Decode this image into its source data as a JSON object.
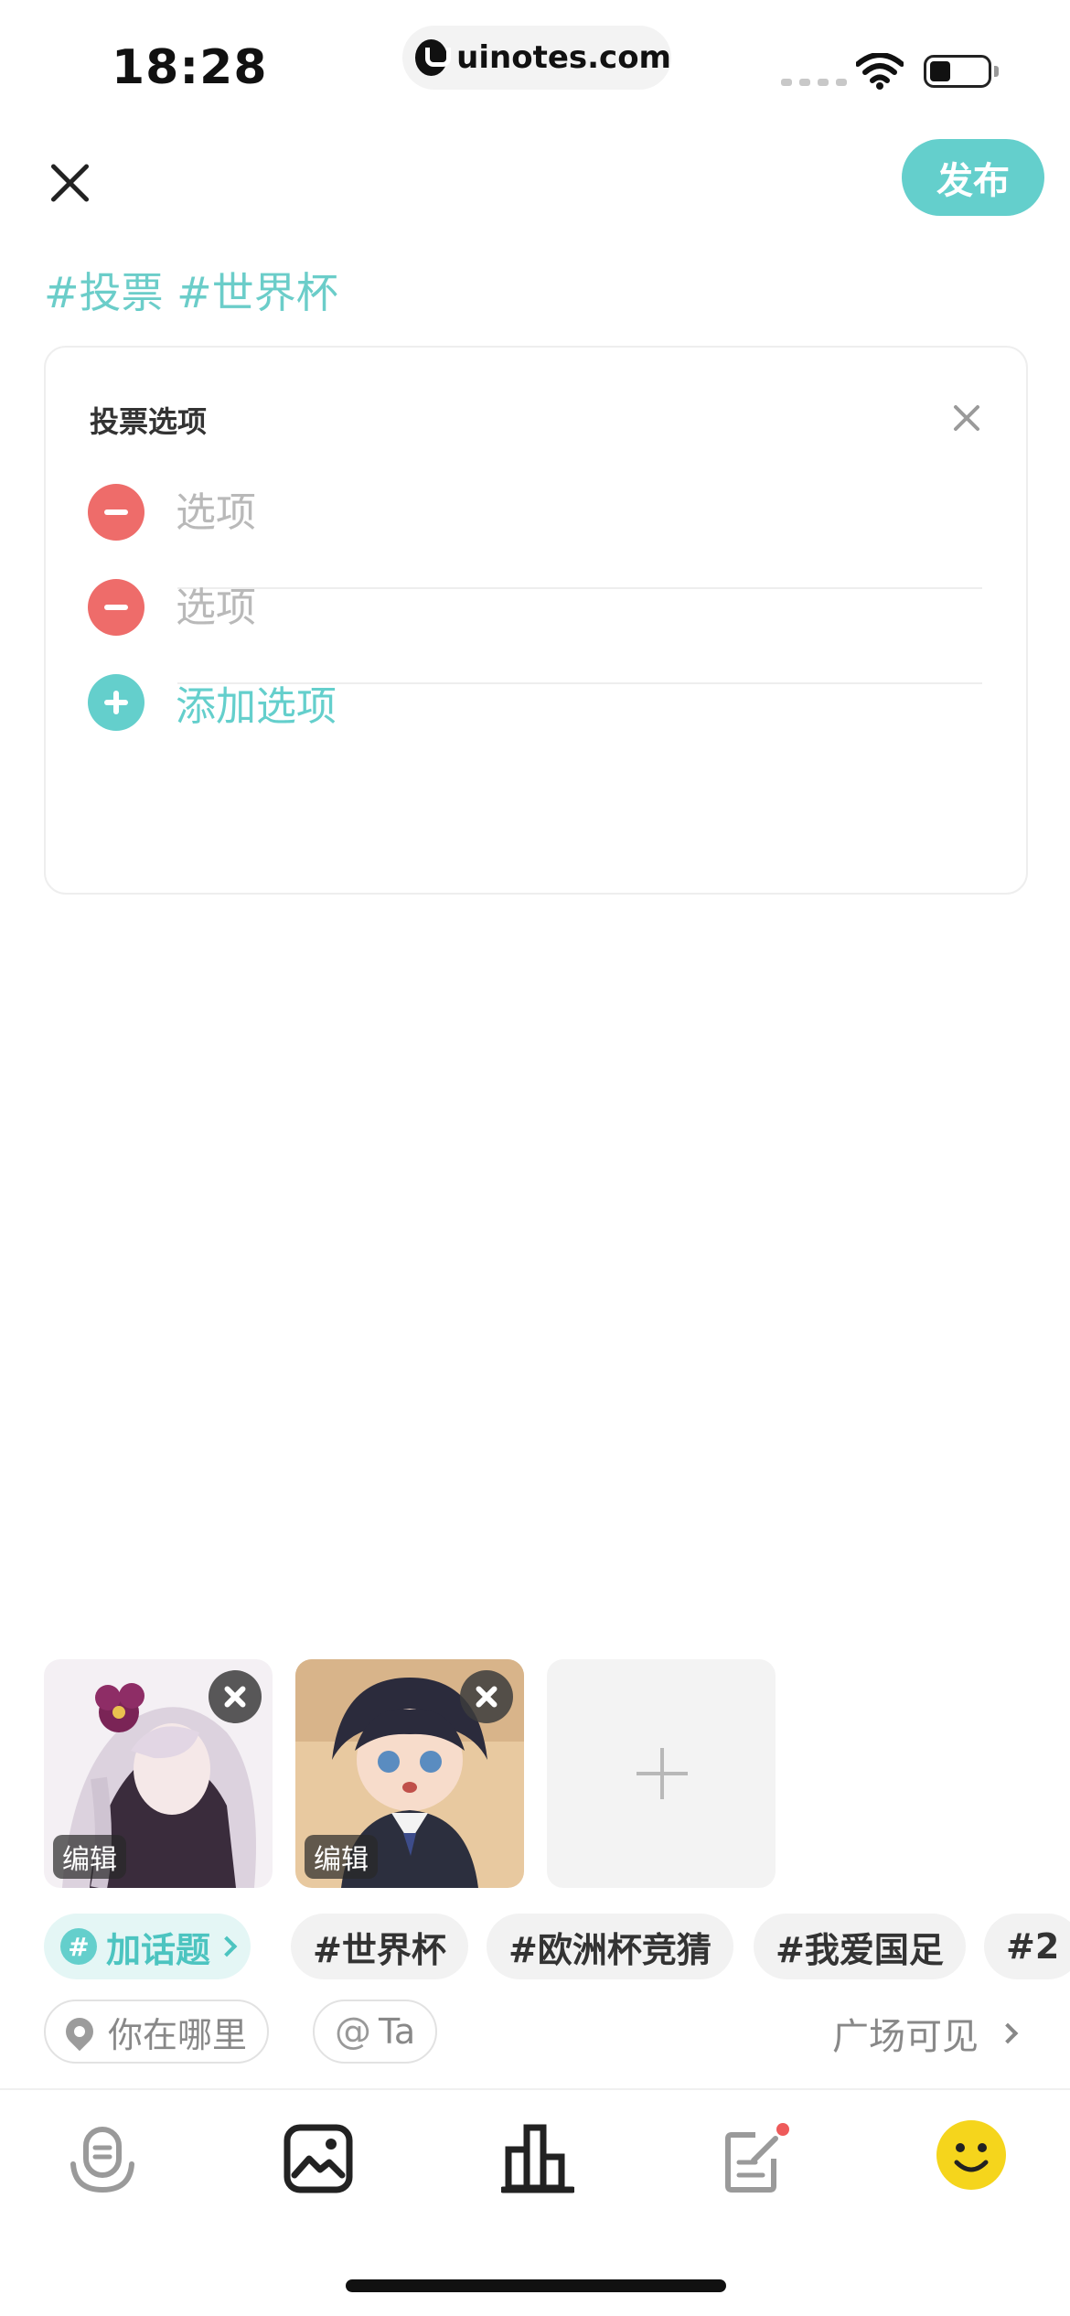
{
  "status_bar": {
    "time": "18:28",
    "url": "uinotes.com"
  },
  "header": {
    "publish_label": "发布"
  },
  "post": {
    "topic_text": "#投票 #世界杯"
  },
  "poll": {
    "title": "投票选项",
    "options": [
      {
        "placeholder": "选项",
        "value": ""
      },
      {
        "placeholder": "选项",
        "value": ""
      }
    ],
    "add_option_label": "添加选项"
  },
  "images": {
    "edit_label": "编辑",
    "items": [
      {
        "name": "anime-girl-flower"
      },
      {
        "name": "anime-girl-uniform"
      }
    ]
  },
  "hashtags": {
    "add_label": "加话题",
    "items": [
      "#世界杯",
      "#欧洲杯竞猜",
      "#我爱国足",
      "#2"
    ]
  },
  "location": {
    "location_label": "你在哪里",
    "mention_label": "Ta",
    "visibility_label": "广场可见"
  },
  "toolbar": {
    "items": [
      {
        "icon": "voice-icon"
      },
      {
        "icon": "image-icon"
      },
      {
        "icon": "poll-icon"
      },
      {
        "icon": "draft-icon",
        "badge": true
      },
      {
        "icon": "emoji-icon"
      }
    ]
  },
  "colors": {
    "accent": "#64cfcc",
    "remove": "#ee6c6a",
    "emoji": "#f5d51c"
  }
}
